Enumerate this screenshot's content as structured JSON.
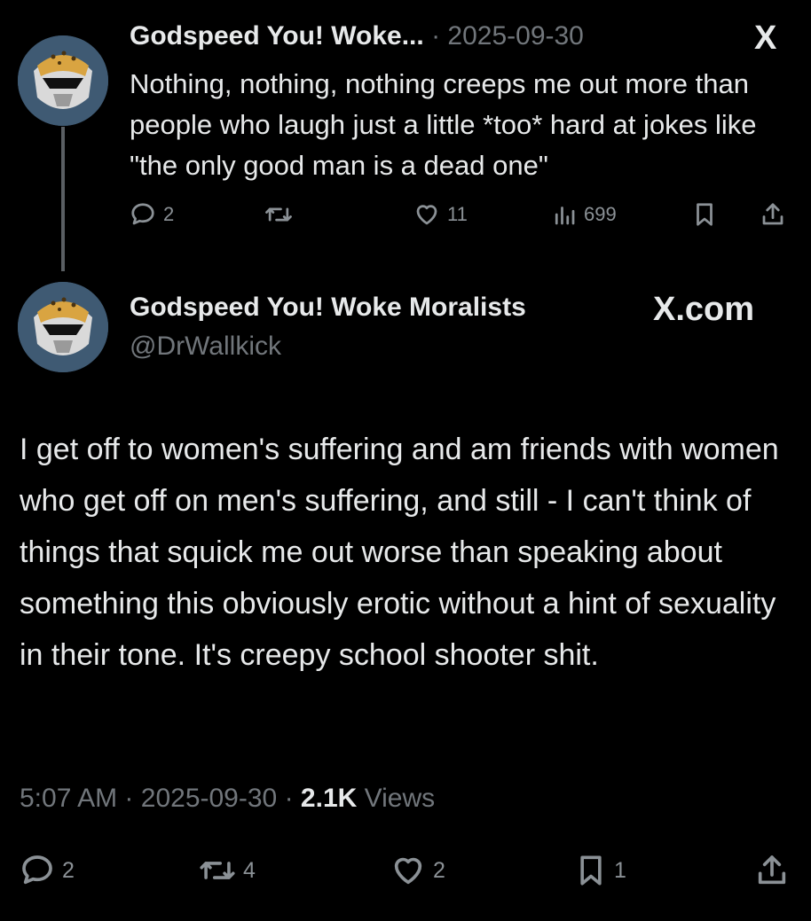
{
  "reply_tweet": {
    "display_name": "Godspeed You! Woke...",
    "separator": "·",
    "date": "2025-09-30",
    "text": "Nothing, nothing, nothing creeps me out more than people who laugh just a little *too* hard at jokes like \"the only good man is a dead one\"",
    "platform_logo": "X",
    "metrics": {
      "replies": "2",
      "likes": "11",
      "views": "699"
    },
    "icons": [
      "reply-icon",
      "retweet-icon",
      "like-icon",
      "views-icon",
      "bookmark-icon",
      "share-icon"
    ]
  },
  "main_tweet": {
    "display_name": "Godspeed You! Woke Moralists",
    "handle": "@DrWallkick",
    "platform_logo": "X.com",
    "text": "I get off to women's suffering and am friends with women who get off on men's suffering, and still - I can't think of things that squick me out worse than speaking about something this obviously erotic without a hint of sexuality in their tone. It's creepy school shooter shit.",
    "time": "5:07 AM",
    "date": "2025-09-30",
    "views_count": "2.1K",
    "views_label": "Views",
    "sep": "·",
    "metrics": {
      "replies": "2",
      "retweets": "4",
      "likes": "2",
      "bookmarks": "1"
    }
  },
  "colors": {
    "background": "#000000",
    "text": "#e7e9ea",
    "muted": "#71767b",
    "avatar_bg": "#3f5a73"
  }
}
